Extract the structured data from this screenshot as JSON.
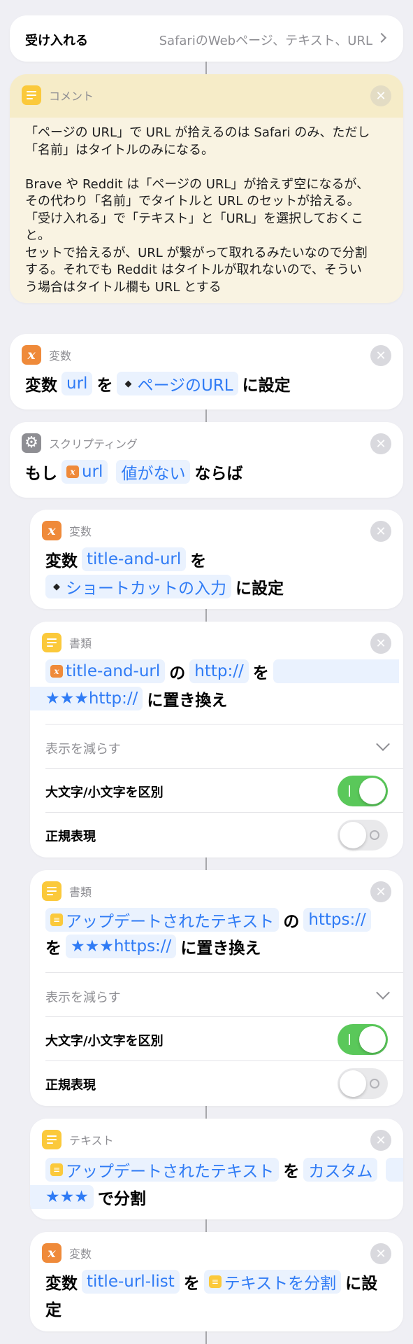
{
  "accept": {
    "label": "受け入れる",
    "value": "SafariのWebページ、テキスト、URL"
  },
  "comment": {
    "category": "コメント",
    "lines": [
      "「ページの URL」で URL が拾えるのは Safari のみ、ただし",
      "「名前」はタイトルのみになる。",
      "",
      "Brave や Reddit は「ページの URL」が拾えず空になるが、",
      "その代わり「名前」でタイトルと URL のセットが拾える。",
      "「受け入れる」で「テキスト」と「URL」を選択しておくこ",
      "と。",
      "セットで拾えるが、URL が繋がって取れるみたいなので分割",
      "する。それでも Reddit はタイトルが取れないので、そうい",
      "う場合はタイトル欄も URL とする"
    ]
  },
  "actions": {
    "set_url": {
      "category": "変数",
      "w1": "変数",
      "token1": "url",
      "w2": "を",
      "token2": "ページのURL",
      "w3": "に設定"
    },
    "if": {
      "category": "スクリプティング",
      "w1": "もし",
      "token1": "url",
      "token2": "値がない",
      "w2": "ならば"
    },
    "set_title": {
      "category": "変数",
      "w1": "変数",
      "token1": "title-and-url",
      "w2": "を",
      "token2": "ショートカットの入力",
      "w3": "に設定"
    },
    "replace1": {
      "category": "書類",
      "token1": "title-and-url",
      "w1": "の",
      "token2": "http://",
      "w2": "を",
      "token3": "★★★http://",
      "w3": "に置き換え",
      "show_less": "表示を減らす",
      "opt1": "大文字/小文字を区別",
      "opt2": "正規表現"
    },
    "replace2": {
      "category": "書類",
      "token1": "アップデートされたテキスト",
      "w1": "の",
      "token2": "https://",
      "w2": "を",
      "token3": "★★★https://",
      "w3": "に置き換え",
      "show_less": "表示を減らす",
      "opt1": "大文字/小文字を区別",
      "opt2": "正規表現"
    },
    "split": {
      "category": "テキスト",
      "token1": "アップデートされたテキスト",
      "w1": "を",
      "token2": "カスタム",
      "token3": "★★★",
      "w2": "で分割"
    },
    "set_list": {
      "category": "変数",
      "w1": "変数",
      "token1": "title-url-list",
      "w2": "を",
      "token2": "テキストを分割",
      "w3": "に設",
      "w4": "定"
    }
  },
  "colors": {
    "accent": "#2f7bf5",
    "toggle_on": "#5ac85a",
    "comment_bg": "#f9f3e2",
    "comment_head": "#f6ecc8"
  }
}
